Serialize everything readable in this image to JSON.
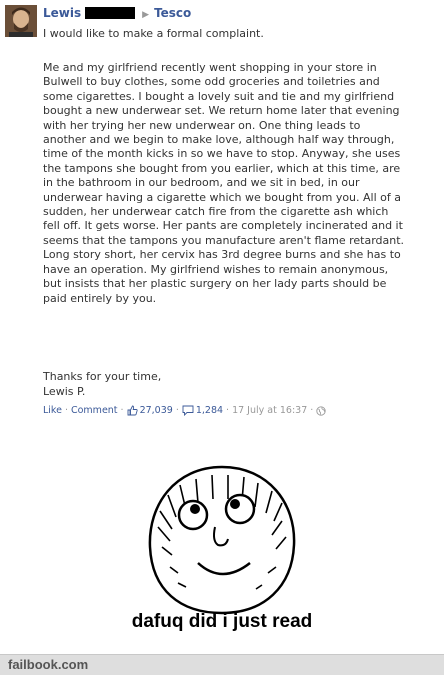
{
  "post": {
    "author": "Lewis",
    "target": "Tesco",
    "lead": "I would like to make a formal complaint.",
    "body": "Me and my girlfriend recently went shopping in your store in\nBulwell to buy clothes, some odd groceries and toiletries and\nsome cigarettes. I bought a lovely suit and tie and my girlfriend\nbought a new underwear set. We return home later that evening\nwith her trying her new underwear on. One thing leads to\nanother and we begin to make love, although half way through,\ntime of the month kicks in so we have to stop. Anyway, she uses\nthe tampons she bought from you earlier, which at this time, are\nin the bathroom in our bedroom, and we sit in bed, in our\nunderwear having a cigarette which we bought from you. All of a\nsudden, her underwear catch fire from the cigarette ash which\nfell off. It gets worse. Her pants are completely incinerated and it\nseems that the tampons you manufacture aren't flame retardant.\nLong story short, her cervix has 3rd degree burns and she has to\nhave an operation. My girlfriend wishes to remain anonymous,\nbut insists that her plastic surgery on her lady parts should be\npaid entirely by you.",
    "thanks_line1": "Thanks for your time,",
    "thanks_line2": "Lewis P.",
    "actions": {
      "like": "Like",
      "comment": "Comment",
      "like_count": "27,039",
      "comment_count": "1,284",
      "timestamp": "17 July at 16:37"
    }
  },
  "meme": {
    "caption": "dafuq did i just read"
  },
  "footer": {
    "brand": "failbook.com"
  },
  "colors": {
    "link": "#3b5998",
    "muted": "#999999",
    "footer_bg": "#dedede"
  }
}
